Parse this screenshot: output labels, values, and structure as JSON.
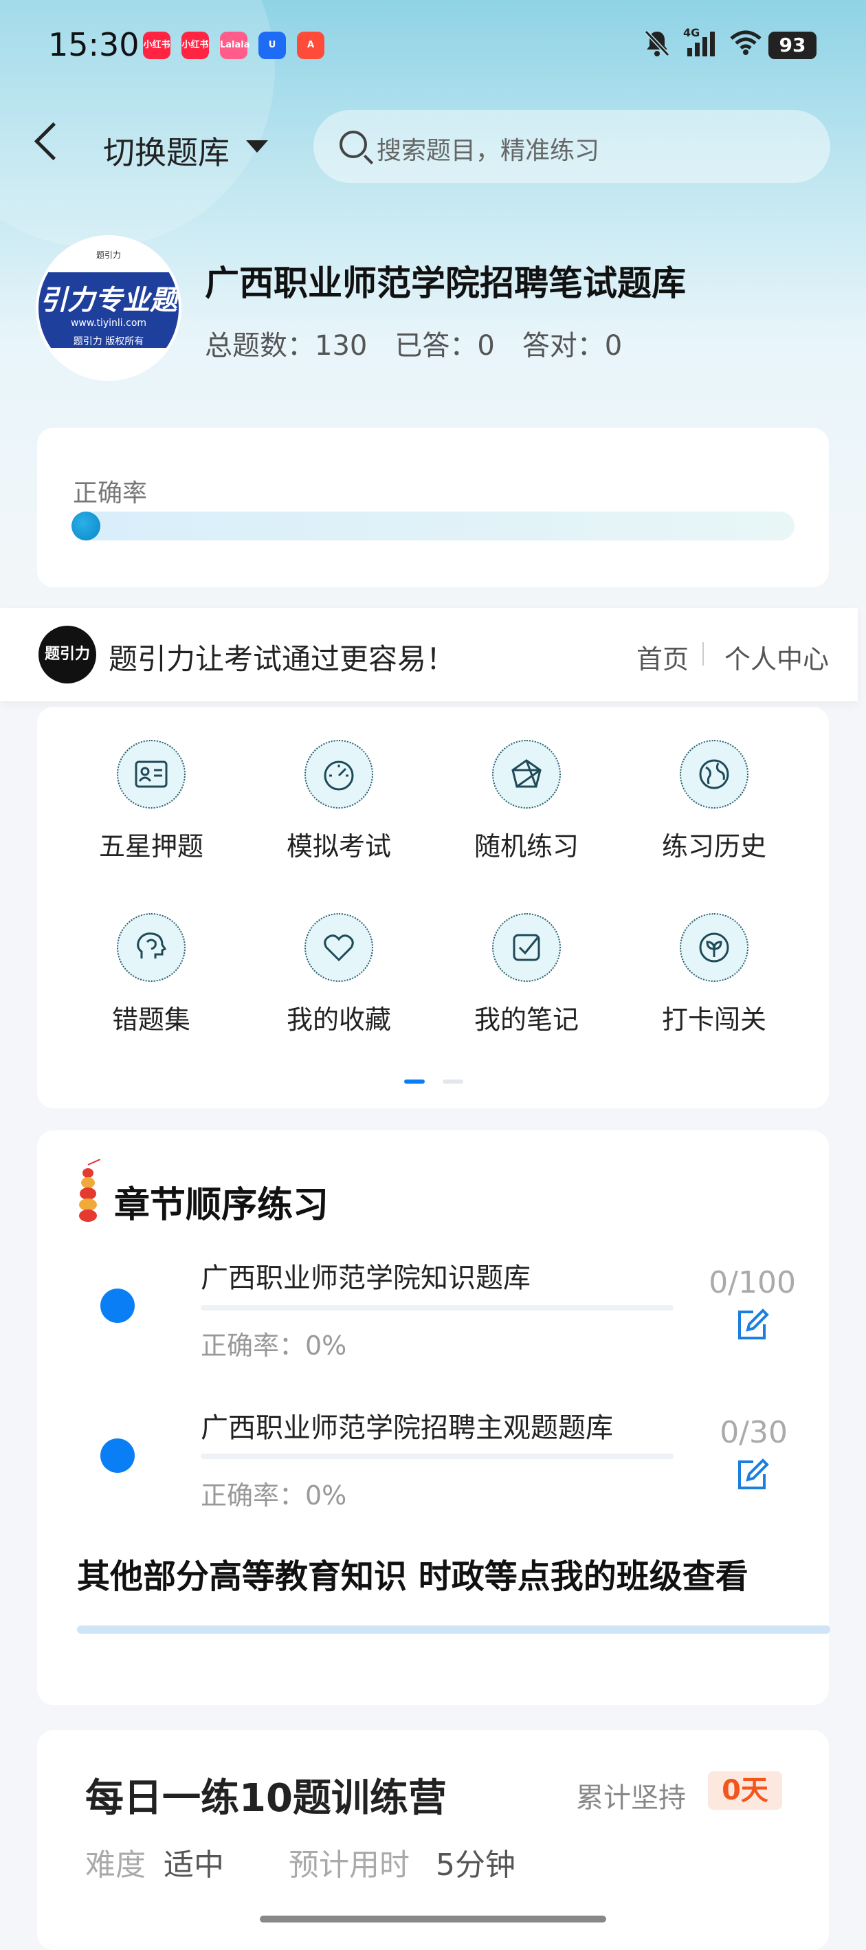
{
  "status_bar": {
    "time": "15:30",
    "apps": [
      {
        "label": "小红书",
        "color": "#ff2442"
      },
      {
        "label": "小红书",
        "color": "#ff2442"
      },
      {
        "label": "Lalala",
        "color": "#ff5c8a"
      },
      {
        "label": "U",
        "color": "#1e6cf5"
      },
      {
        "label": "A",
        "color": "#ff4b3a"
      }
    ],
    "network": "4G",
    "battery": "93"
  },
  "nav": {
    "switch_label": "切换题库",
    "search_placeholder": "搜索题目，精准练习"
  },
  "bank": {
    "logo_text": "引力专业题",
    "logo_url": "www.tiyinli.com",
    "logo_rights": "题引力 版权所有",
    "logo_top": "题引力",
    "title": "广西职业师范学院招聘笔试题库",
    "total_label": "总题数：130",
    "answered_label": "已答：0",
    "correct_label": "答对：0"
  },
  "accuracy": {
    "label": "正确率",
    "value": 0
  },
  "promo": {
    "logo_text": "题引力",
    "slogan": "题引力让考试通过更容易！",
    "home_link": "首页",
    "center_link": "个人中心"
  },
  "features": [
    {
      "label": "五星押题",
      "icon": "id-card-icon"
    },
    {
      "label": "模拟考试",
      "icon": "speedometer-icon"
    },
    {
      "label": "随机练习",
      "icon": "random-icon"
    },
    {
      "label": "练习历史",
      "icon": "globe-icon"
    },
    {
      "label": "错题集",
      "icon": "brain-icon"
    },
    {
      "label": "我的收藏",
      "icon": "heart-icon"
    },
    {
      "label": "我的笔记",
      "icon": "checkbox-note-icon"
    },
    {
      "label": "打卡闯关",
      "icon": "leaf-icon"
    }
  ],
  "chapters": {
    "title": "章节顺序练习",
    "items": [
      {
        "name": "广西职业师范学院知识题库",
        "rate": "正确率：0%",
        "count": "0/100"
      },
      {
        "name": "广西职业师范学院招聘主观题题库",
        "rate": "正确率：0%",
        "count": "0/30"
      }
    ],
    "other_text": "其他部分高等教育知识 时政等点我的班级查看"
  },
  "daily": {
    "title": "每日一练10题训练营",
    "streak_label": "累计坚持",
    "streak_value": "0天",
    "difficulty_label": "难度",
    "difficulty_value": "适中",
    "time_label": "预计用时",
    "time_value": "5分钟"
  },
  "colors": {
    "accent": "#0a7ff5",
    "streak": "#f2561d"
  }
}
